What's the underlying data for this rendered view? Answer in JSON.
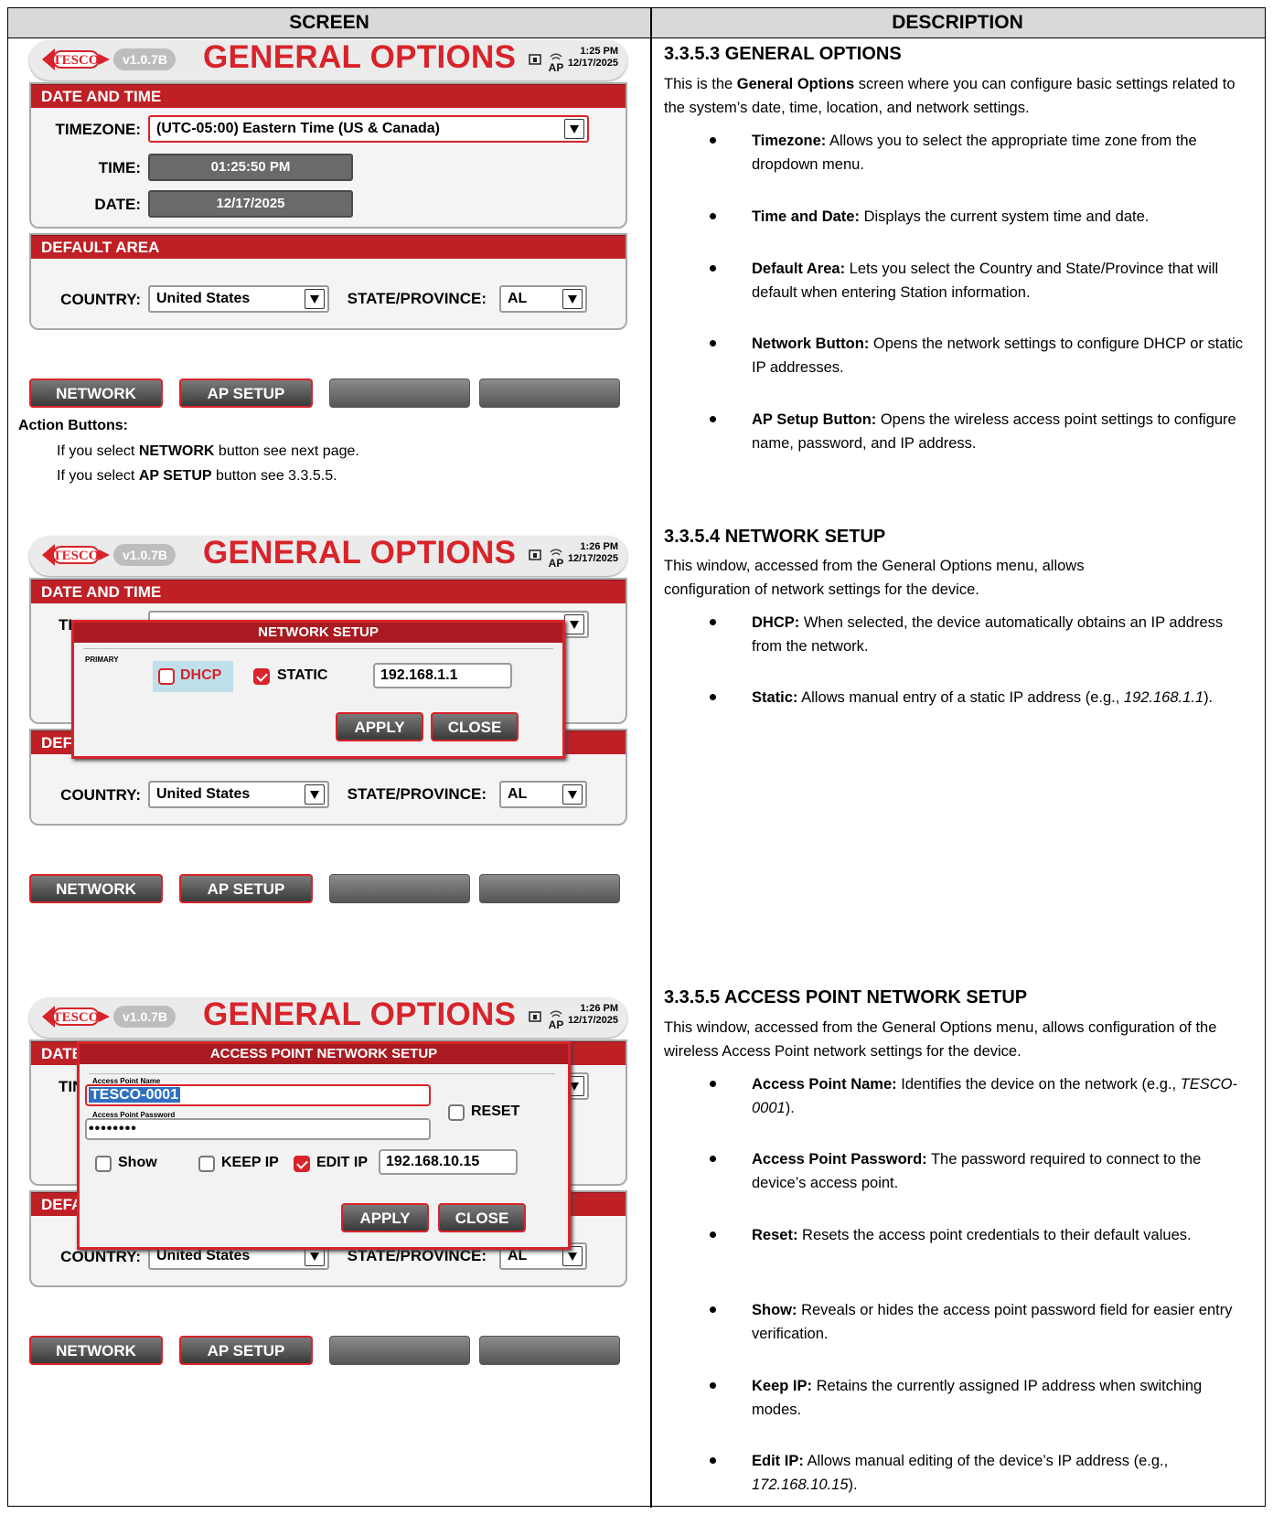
{
  "table": {
    "col_screen": "SCREEN",
    "col_description": "DESCRIPTION"
  },
  "screen": {
    "version": "v1.0.7B",
    "title": "GENERAL OPTIONS",
    "status_ap": "AP",
    "date_time_header": "DATE AND TIME",
    "timezone_label": "TIMEZONE:",
    "timezone_value": "(UTC-05:00) Eastern Time (US & Canada)",
    "time_label": "TIME:",
    "date_label": "DATE:",
    "default_area_header": "DEFAULT AREA",
    "default_area_header_cut": "DEF/",
    "default_area_header_cut2": "DEFA",
    "date_header_cut": "DATE",
    "tz_label_cut": "TI",
    "tz_label_cut2": "TIN",
    "country_label": "COUNTRY:",
    "country_value": "United States",
    "state_label": "STATE/PROVINCE:",
    "state_value": "AL",
    "network_btn": "NETWORK",
    "ap_setup_btn": "AP SETUP"
  },
  "screens": [
    {
      "clock_time": "1:25 PM",
      "clock_date": "12/17/2025",
      "time_value": "01:25:50 PM",
      "date_value": "12/17/2025"
    },
    {
      "clock_time": "1:26 PM",
      "clock_date": "12/17/2025"
    },
    {
      "clock_time": "1:26 PM",
      "clock_date": "12/17/2025"
    }
  ],
  "action_buttons": {
    "heading": "Action Buttons:",
    "line1_pre": "If you select ",
    "line1_bold": "NETWORK",
    "line1_post": " button see next page.",
    "line2_pre": "If you select ",
    "line2_bold": "AP SETUP",
    "line2_post": " button see 3.3.5.5."
  },
  "network_dialog": {
    "title": "NETWORK SETUP",
    "primary_label": "PRIMARY",
    "dhcp_label": "DHCP",
    "static_label": "STATIC",
    "ip_value": "192.168.1.1",
    "apply": "APPLY",
    "close": "CLOSE"
  },
  "ap_dialog": {
    "title": "ACCESS POINT NETWORK SETUP",
    "name_label": "Access Point Name",
    "name_value": "TESCO-0001",
    "password_label": "Access Point Password",
    "password_value": "••••••••",
    "reset_label": "RESET",
    "show_label": "Show",
    "keep_ip_label": "KEEP IP",
    "edit_ip_label": "EDIT IP",
    "ip_value": "192.168.10.15",
    "apply": "APPLY",
    "close": "CLOSE"
  },
  "descriptions": {
    "s1": {
      "heading": "3.3.5.3 GENERAL OPTIONS",
      "intro_pre": "This is the ",
      "intro_bold": "General Options",
      "intro_post": " screen where you can configure basic settings related to the system’s date, time, location, and network settings.",
      "bullets": [
        {
          "term": "Timezone:",
          "text": " Allows you to select the appropriate time zone from the dropdown menu."
        },
        {
          "term": "Time and Date:",
          "text": " Displays the current system time and date."
        },
        {
          "term": "Default Area:",
          "text": " Lets you select the Country and State/Province that will default when entering Station information."
        },
        {
          "term": "Network Button:",
          "text": " Opens the network settings to configure DHCP or static IP addresses."
        },
        {
          "term": "AP Setup Button:",
          "text": " Opens the wireless access point settings to configure name, password, and IP address."
        }
      ]
    },
    "s2": {
      "heading": "3.3.5.4 NETWORK SETUP",
      "intro": "This window, accessed from the General Options menu, allows configuration of network settings for the device.",
      "bullets": [
        {
          "term": "DHCP:",
          "text": " When selected, the device automatically obtains an IP address from the network."
        },
        {
          "term": "Static:",
          "text": " Allows manual entry of a static IP address (e.g., ",
          "example": "192.168.1.1",
          "tail": ")."
        }
      ]
    },
    "s3": {
      "heading": "3.3.5.5 ACCESS POINT NETWORK SETUP",
      "intro": "This window, accessed from the General Options menu, allows configuration of the wireless Access Point network settings for the device.",
      "bullets": [
        {
          "term": "Access Point Name:",
          "text": " Identifies the device on the network (e.g., ",
          "example": "TESCO-0001",
          "tail": ")."
        },
        {
          "term": "Access Point Password:",
          "text": " The password required to connect to the device’s access point."
        },
        {
          "term": "Reset:",
          "text": " Resets the access point credentials to their default values."
        },
        {
          "term": "Show:",
          "text": " Reveals or hides the access point password field for easier entry verification."
        },
        {
          "term": "Keep IP:",
          "text": " Retains the currently assigned IP address when switching modes."
        },
        {
          "term": "Edit IP:",
          "text": " Allows manual editing of the device’s IP address (e.g., ",
          "example": "172.168.10.15",
          "tail": ")."
        }
      ]
    }
  },
  "colors": {
    "brand_red": "#d8232a",
    "header_red": "#bf2026"
  }
}
